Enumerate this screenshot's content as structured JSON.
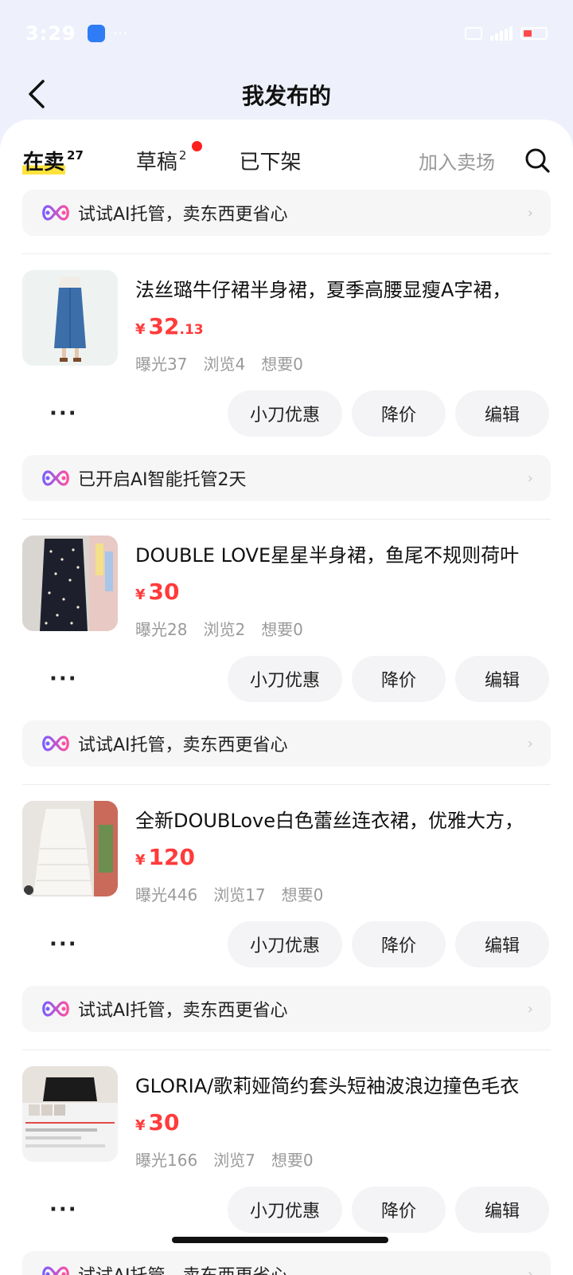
{
  "status_bar": {
    "time": "3:29",
    "dots": "···"
  },
  "header": {
    "title": "我发布的"
  },
  "tabs": [
    {
      "label": "在卖",
      "count": "27",
      "active": true
    },
    {
      "label": "草稿",
      "count": "2",
      "active": false,
      "dot": true
    },
    {
      "label": "已下架",
      "count": "",
      "active": false
    }
  ],
  "toolbar": {
    "join_market": "加入卖场"
  },
  "top_banner": {
    "text": "试试AI托管，卖东西更省心"
  },
  "items": [
    {
      "title": "法丝璐牛仔裙半身裙，夏季高腰显瘦A字裙，",
      "price_symbol": "¥",
      "price_int": "32",
      "price_dec": ".13",
      "stats": {
        "exposure": "曝光37",
        "views": "浏览4",
        "wants": "想要0"
      },
      "actions": {
        "more": "···",
        "knife": "小刀优惠",
        "price_cut": "降价",
        "edit": "编辑"
      },
      "banner": "已开启AI智能托管2天"
    },
    {
      "title": "DOUBLE LOVE星星半身裙，鱼尾不规则荷叶",
      "price_symbol": "¥",
      "price_int": "30",
      "price_dec": "",
      "stats": {
        "exposure": "曝光28",
        "views": "浏览2",
        "wants": "想要0"
      },
      "actions": {
        "more": "···",
        "knife": "小刀优惠",
        "price_cut": "降价",
        "edit": "编辑"
      },
      "banner": "试试AI托管，卖东西更省心"
    },
    {
      "title": "全新DOUBLove白色蕾丝连衣裙，优雅大方，",
      "price_symbol": "¥",
      "price_int": "120",
      "price_dec": "",
      "stats": {
        "exposure": "曝光446",
        "views": "浏览17",
        "wants": "想要0"
      },
      "actions": {
        "more": "···",
        "knife": "小刀优惠",
        "price_cut": "降价",
        "edit": "编辑"
      },
      "banner": "试试AI托管，卖东西更省心"
    },
    {
      "title": "GLORIA/歌莉娅简约套头短袖波浪边撞色毛衣",
      "price_symbol": "¥",
      "price_int": "30",
      "price_dec": "",
      "stats": {
        "exposure": "曝光166",
        "views": "浏览7",
        "wants": "想要0"
      },
      "actions": {
        "more": "···",
        "knife": "小刀优惠",
        "price_cut": "降价",
        "edit": "编辑"
      },
      "banner": "试试AI托管，卖东西更省心"
    }
  ],
  "colors": {
    "accent_yellow": "#ffe33c",
    "price_red": "#ff3b3b",
    "dot_red": "#ff1f1f",
    "header_bg": "#eef1fb"
  },
  "icons": {
    "back": "chevron-left-icon",
    "search": "search-icon",
    "ai": "ai-infinity-icon",
    "chevron": "chevron-right-icon"
  }
}
